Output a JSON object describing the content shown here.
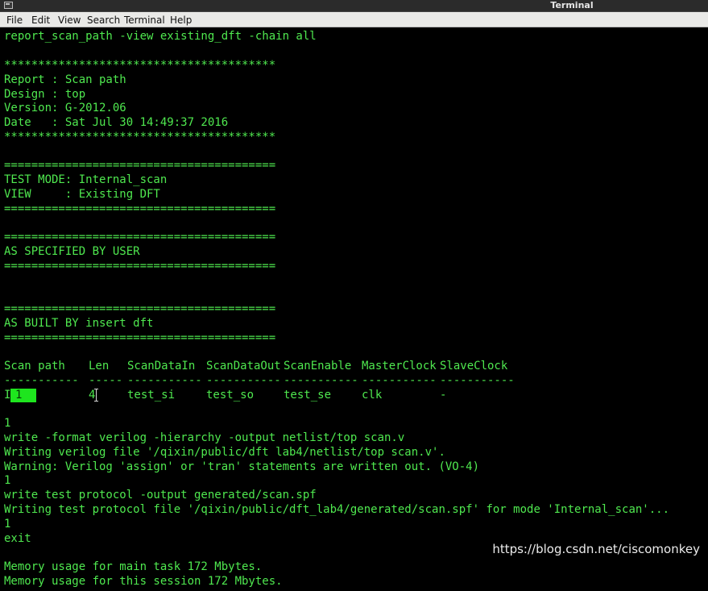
{
  "window": {
    "title": "Terminal",
    "icon": "terminal-window-icon"
  },
  "menubar": {
    "items": [
      "File",
      "Edit",
      "View",
      "Search",
      "Terminal",
      "Help"
    ]
  },
  "colors": {
    "terminal_bg": "#000000",
    "terminal_text": "#4fe84f",
    "highlight_bg": "#1ee51e",
    "menubar_bg": "#e9e9e7",
    "titlebar_bg": "#2b2b2b"
  },
  "terminal": {
    "lines_top": [
      "report_scan_path -view existing_dft -chain all",
      "",
      "****************************************",
      "Report : Scan path",
      "Design : top",
      "Version: G-2012.06",
      "Date   : Sat Jul 30 14:49:37 2016",
      "****************************************",
      "",
      "========================================",
      "TEST MODE: Internal_scan",
      "VIEW     : Existing DFT",
      "========================================",
      "",
      "========================================",
      "AS SPECIFIED BY USER",
      "========================================",
      "",
      "",
      "",
      "========================================",
      "AS BUILT BY insert dft",
      "========================================"
    ],
    "scan_table": {
      "headers": [
        "Scan path",
        "Len",
        "ScanDataIn",
        "ScanDataOut",
        "ScanEnable",
        "MasterClock",
        "SlaveClock"
      ],
      "separators": [
        "-----------",
        "-----",
        "-----------",
        "-----------",
        "-----------",
        "-----------",
        "-----------"
      ],
      "row": {
        "prefix": "I",
        "chain": "1",
        "len": "4",
        "scan_data_in": "test_si",
        "scan_data_out": "test_so",
        "scan_enable": "test_se",
        "master_clock": "clk",
        "slave_clock": "-"
      }
    },
    "lines_bottom": [
      "1",
      "write -format verilog -hierarchy -output netlist/top scan.v",
      "Writing verilog file '/qixin/public/dft lab4/netlist/top scan.v'.",
      "Warning: Verilog 'assign' or 'tran' statements are written out. (VO-4)",
      "1",
      "write test protocol -output generated/scan.spf",
      "Writing test protocol file '/qixin/public/dft_lab4/generated/scan.spf' for mode 'Internal_scan'...",
      "1",
      "exit",
      "",
      "Memory usage for main task 172 Mbytes.",
      "Memory usage for this session 172 Mbytes."
    ]
  },
  "watermark": "https://blog.csdn.net/ciscomonkey"
}
